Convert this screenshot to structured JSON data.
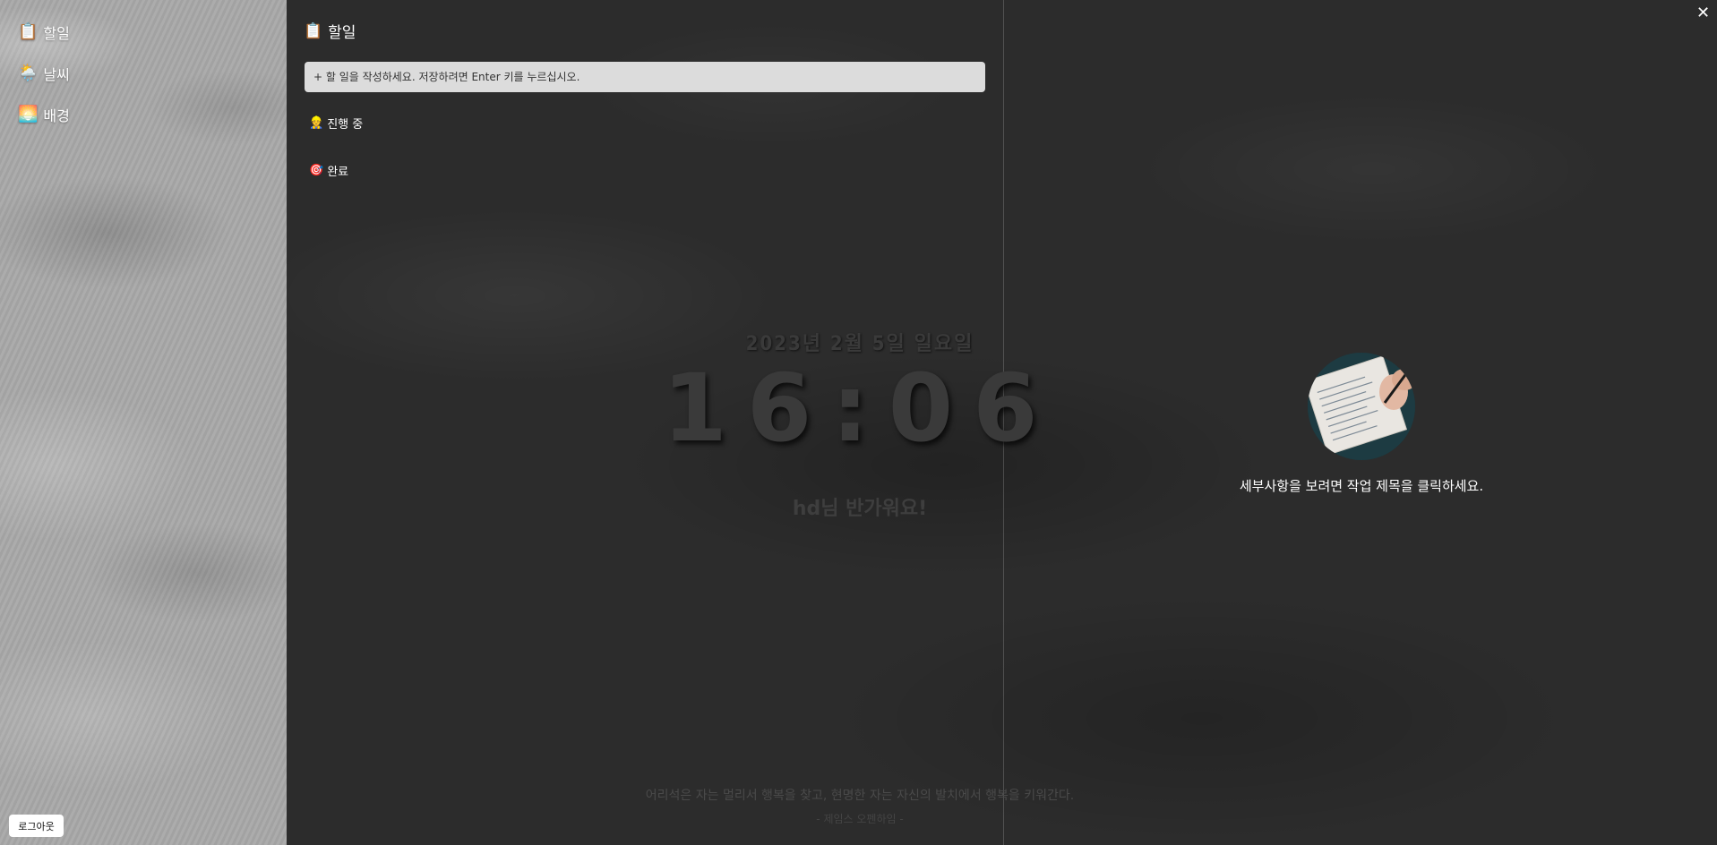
{
  "sidebar": {
    "items": [
      {
        "icon": "clipboard-icon",
        "emoji": "📋",
        "label": "할일"
      },
      {
        "icon": "weather-icon",
        "emoji": "🌦️",
        "label": "날씨"
      },
      {
        "icon": "landscape-icon",
        "emoji": "🌅",
        "label": "배경"
      }
    ],
    "logout_label": "로그아웃"
  },
  "todo": {
    "title_emoji": "📋",
    "title": "할일",
    "input_placeholder": "+ 할 일을 작성하세요. 저장하려면 Enter 키를 누르십시오.",
    "sections": [
      {
        "icon": "worker-icon",
        "emoji": "👷",
        "label": "진행 중"
      },
      {
        "icon": "target-icon",
        "emoji": "🎯",
        "label": "완료"
      }
    ]
  },
  "clock": {
    "date": "2023년 2월 5일 일요일",
    "time": "16:06",
    "greeting": "hd님 반가워요!"
  },
  "quote": {
    "text": "어리석은 자는 멀리서 행복을 찾고, 현명한 자는 자신의 발치에서 행복을 키워간다.",
    "author": "- 제임스 오펜하임 -"
  },
  "detail": {
    "image_icon": "notebook-writing-image",
    "message": "세부사항을 보려면 작업 제목을 클릭하세요."
  },
  "window": {
    "close_glyph": "✕"
  }
}
